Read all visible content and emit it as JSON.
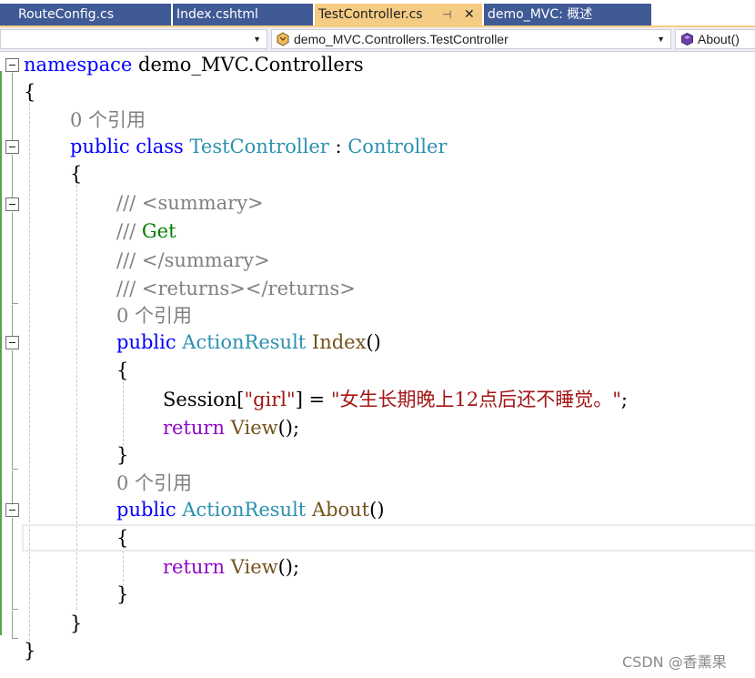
{
  "tabs": [
    {
      "label": "RouteConfig.cs",
      "active": false
    },
    {
      "label": "Index.cshtml",
      "active": false
    },
    {
      "label": "TestController.cs",
      "active": true,
      "pin_glyph": "⊣",
      "close_glyph": "✕"
    },
    {
      "label": "demo_MVC: 概述",
      "active": false
    }
  ],
  "navbar": {
    "project_combo": "",
    "type_combo": "demo_MVC.Controllers.TestController",
    "member_combo": "About()"
  },
  "code": {
    "namespace_kw": "namespace",
    "namespace_name": " demo_MVC.Controllers",
    "brace_open": "{",
    "brace_close": "}",
    "ref_count": "0 个引用",
    "public_kw": "public",
    "class_kw": " class ",
    "class_name": "TestController",
    "colon": " : ",
    "base_class": "Controller",
    "doc_summary_open_slash": "/// ",
    "doc_summary_open": "<summary>",
    "doc_get_slash": "/// ",
    "doc_get": "Get",
    "doc_summary_close_slash": "/// ",
    "doc_summary_close": "</summary>",
    "doc_returns_slash": "/// ",
    "doc_returns": "<returns></returns>",
    "return_type": " ActionResult ",
    "method_index": "Index",
    "method_about": "About",
    "parens": "()",
    "session": "Session[",
    "session_key": "\"girl\"",
    "session_assign": "] = ",
    "session_value": "\"女生长期晚上12点后还不睡觉。\"",
    "semicolon": ";",
    "return_kw": "return",
    "view_call": " View",
    "view_tail": "();"
  },
  "watermark": "CSDN @香薰果",
  "colors": {
    "keyword": "#0000ff",
    "type": "#2b91af",
    "comment": "#808080",
    "doc_text": "#008000",
    "string": "#a31515",
    "method": "#74531f",
    "control": "#8f08c4",
    "tab_active": "#f5cc84",
    "tab_inactive": "#405a96"
  }
}
